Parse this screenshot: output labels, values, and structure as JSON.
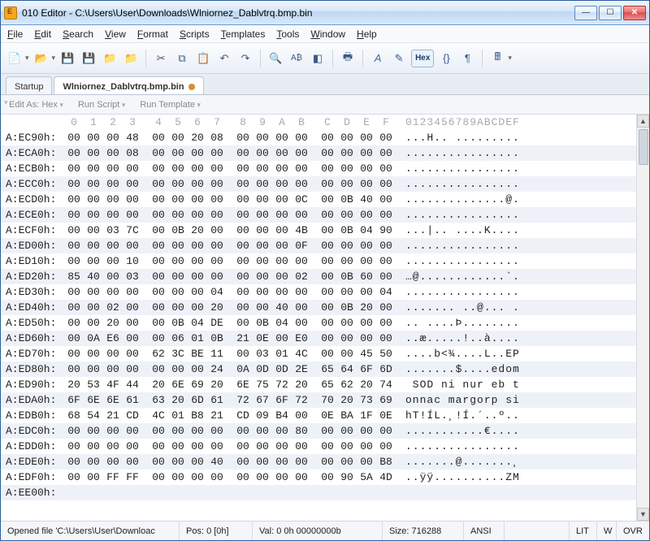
{
  "title": "010 Editor - C:\\Users\\User\\Downloads\\Wlniornez_Dablvtrq.bmp.bin",
  "menu": [
    "File",
    "Edit",
    "Search",
    "View",
    "Format",
    "Scripts",
    "Templates",
    "Tools",
    "Window",
    "Help"
  ],
  "tabs": {
    "startup": "Startup",
    "active": "Wlniornez_Dablvtrq.bmp.bin"
  },
  "editbar": {
    "editas": "Edit As: Hex",
    "runscript": "Run Script",
    "runtpl": "Run Template"
  },
  "hex_header_cols": [
    "0",
    "1",
    "2",
    "3",
    "4",
    "5",
    "6",
    "7",
    "8",
    "9",
    "A",
    "B",
    "C",
    "D",
    "E",
    "F"
  ],
  "hex_header_asc": "0123456789ABCDEF",
  "rows": [
    {
      "addr": "A:EC90h:",
      "hex": [
        "00",
        "00",
        "00",
        "48",
        "00",
        "00",
        "20",
        "08",
        "00",
        "00",
        "00",
        "00",
        "00",
        "00",
        "00",
        "00"
      ],
      "asc": "...H.. ........."
    },
    {
      "addr": "A:ECA0h:",
      "hex": [
        "00",
        "00",
        "00",
        "08",
        "00",
        "00",
        "00",
        "00",
        "00",
        "00",
        "00",
        "00",
        "00",
        "00",
        "00",
        "00"
      ],
      "asc": "................"
    },
    {
      "addr": "A:ECB0h:",
      "hex": [
        "00",
        "00",
        "00",
        "00",
        "00",
        "00",
        "00",
        "00",
        "00",
        "00",
        "00",
        "00",
        "00",
        "00",
        "00",
        "00"
      ],
      "asc": "................"
    },
    {
      "addr": "A:ECC0h:",
      "hex": [
        "00",
        "00",
        "00",
        "00",
        "00",
        "00",
        "00",
        "00",
        "00",
        "00",
        "00",
        "00",
        "00",
        "00",
        "00",
        "00"
      ],
      "asc": "................"
    },
    {
      "addr": "A:ECD0h:",
      "hex": [
        "00",
        "00",
        "00",
        "00",
        "00",
        "00",
        "00",
        "00",
        "00",
        "00",
        "00",
        "0C",
        "00",
        "0B",
        "40",
        "00"
      ],
      "asc": "..............@."
    },
    {
      "addr": "A:ECE0h:",
      "hex": [
        "00",
        "00",
        "00",
        "00",
        "00",
        "00",
        "00",
        "00",
        "00",
        "00",
        "00",
        "00",
        "00",
        "00",
        "00",
        "00"
      ],
      "asc": "................"
    },
    {
      "addr": "A:ECF0h:",
      "hex": [
        "00",
        "00",
        "03",
        "7C",
        "00",
        "0B",
        "20",
        "00",
        "00",
        "00",
        "00",
        "4B",
        "00",
        "0B",
        "04",
        "90"
      ],
      "asc": "...|.. ....K...."
    },
    {
      "addr": "A:ED00h:",
      "hex": [
        "00",
        "00",
        "00",
        "00",
        "00",
        "00",
        "00",
        "00",
        "00",
        "00",
        "00",
        "0F",
        "00",
        "00",
        "00",
        "00"
      ],
      "asc": "................"
    },
    {
      "addr": "A:ED10h:",
      "hex": [
        "00",
        "00",
        "00",
        "10",
        "00",
        "00",
        "00",
        "00",
        "00",
        "00",
        "00",
        "00",
        "00",
        "00",
        "00",
        "00"
      ],
      "asc": "................"
    },
    {
      "addr": "A:ED20h:",
      "hex": [
        "85",
        "40",
        "00",
        "03",
        "00",
        "00",
        "00",
        "00",
        "00",
        "00",
        "00",
        "02",
        "00",
        "0B",
        "60",
        "00"
      ],
      "asc": "…@............`."
    },
    {
      "addr": "A:ED30h:",
      "hex": [
        "00",
        "00",
        "00",
        "00",
        "00",
        "00",
        "00",
        "04",
        "00",
        "00",
        "00",
        "00",
        "00",
        "00",
        "00",
        "04"
      ],
      "asc": "................"
    },
    {
      "addr": "A:ED40h:",
      "hex": [
        "00",
        "00",
        "02",
        "00",
        "00",
        "00",
        "00",
        "20",
        "00",
        "00",
        "40",
        "00",
        "00",
        "0B",
        "20",
        "00"
      ],
      "asc": "....... ..@... ."
    },
    {
      "addr": "A:ED50h:",
      "hex": [
        "00",
        "00",
        "20",
        "00",
        "00",
        "0B",
        "04",
        "DE",
        "00",
        "0B",
        "04",
        "00",
        "00",
        "00",
        "00",
        "00"
      ],
      "asc": ".. ....Þ........"
    },
    {
      "addr": "A:ED60h:",
      "hex": [
        "00",
        "0A",
        "E6",
        "00",
        "00",
        "06",
        "01",
        "0B",
        "21",
        "0E",
        "00",
        "E0",
        "00",
        "00",
        "00",
        "00"
      ],
      "asc": "..æ.....!..à...."
    },
    {
      "addr": "A:ED70h:",
      "hex": [
        "00",
        "00",
        "00",
        "00",
        "62",
        "3C",
        "BE",
        "11",
        "00",
        "03",
        "01",
        "4C",
        "00",
        "00",
        "45",
        "50"
      ],
      "asc": "....b<¾....L..EP"
    },
    {
      "addr": "A:ED80h:",
      "hex": [
        "00",
        "00",
        "00",
        "00",
        "00",
        "00",
        "00",
        "24",
        "0A",
        "0D",
        "0D",
        "2E",
        "65",
        "64",
        "6F",
        "6D"
      ],
      "asc": ".......$....edom"
    },
    {
      "addr": "A:ED90h:",
      "hex": [
        "20",
        "53",
        "4F",
        "44",
        "20",
        "6E",
        "69",
        "20",
        "6E",
        "75",
        "72",
        "20",
        "65",
        "62",
        "20",
        "74"
      ],
      "asc": " SOD ni nur eb t"
    },
    {
      "addr": "A:EDA0h:",
      "hex": [
        "6F",
        "6E",
        "6E",
        "61",
        "63",
        "20",
        "6D",
        "61",
        "72",
        "67",
        "6F",
        "72",
        "70",
        "20",
        "73",
        "69"
      ],
      "asc": "onnac margorp si"
    },
    {
      "addr": "A:EDB0h:",
      "hex": [
        "68",
        "54",
        "21",
        "CD",
        "4C",
        "01",
        "B8",
        "21",
        "CD",
        "09",
        "B4",
        "00",
        "0E",
        "BA",
        "1F",
        "0E"
      ],
      "asc": "hT!ÍL.¸!Í.´..º.."
    },
    {
      "addr": "A:EDC0h:",
      "hex": [
        "00",
        "00",
        "00",
        "00",
        "00",
        "00",
        "00",
        "00",
        "00",
        "00",
        "00",
        "80",
        "00",
        "00",
        "00",
        "00"
      ],
      "asc": "...........€...."
    },
    {
      "addr": "A:EDD0h:",
      "hex": [
        "00",
        "00",
        "00",
        "00",
        "00",
        "00",
        "00",
        "00",
        "00",
        "00",
        "00",
        "00",
        "00",
        "00",
        "00",
        "00"
      ],
      "asc": "................"
    },
    {
      "addr": "A:EDE0h:",
      "hex": [
        "00",
        "00",
        "00",
        "00",
        "00",
        "00",
        "00",
        "40",
        "00",
        "00",
        "00",
        "00",
        "00",
        "00",
        "00",
        "B8"
      ],
      "asc": ".......@.......¸"
    },
    {
      "addr": "A:EDF0h:",
      "hex": [
        "00",
        "00",
        "FF",
        "FF",
        "00",
        "00",
        "00",
        "00",
        "00",
        "00",
        "00",
        "00",
        "00",
        "90",
        "5A",
        "4D"
      ],
      "asc": "..ÿÿ..........ZM"
    },
    {
      "addr": "A:EE00h:",
      "hex": [
        "",
        "",
        "",
        "",
        "",
        "",
        "",
        "",
        "",
        "",
        "",
        "",
        "",
        "",
        "",
        ""
      ],
      "asc": ""
    }
  ],
  "status": {
    "opened": "Opened file 'C:\\Users\\User\\Downloac",
    "pos": "Pos: 0 [0h]",
    "val": "Val: 0 0h 00000000b",
    "size": "Size: 716288",
    "enc": "ANSI",
    "lit": "LIT",
    "w": "W",
    "ovr": "OVR"
  },
  "toolbar_hex": "Hex"
}
